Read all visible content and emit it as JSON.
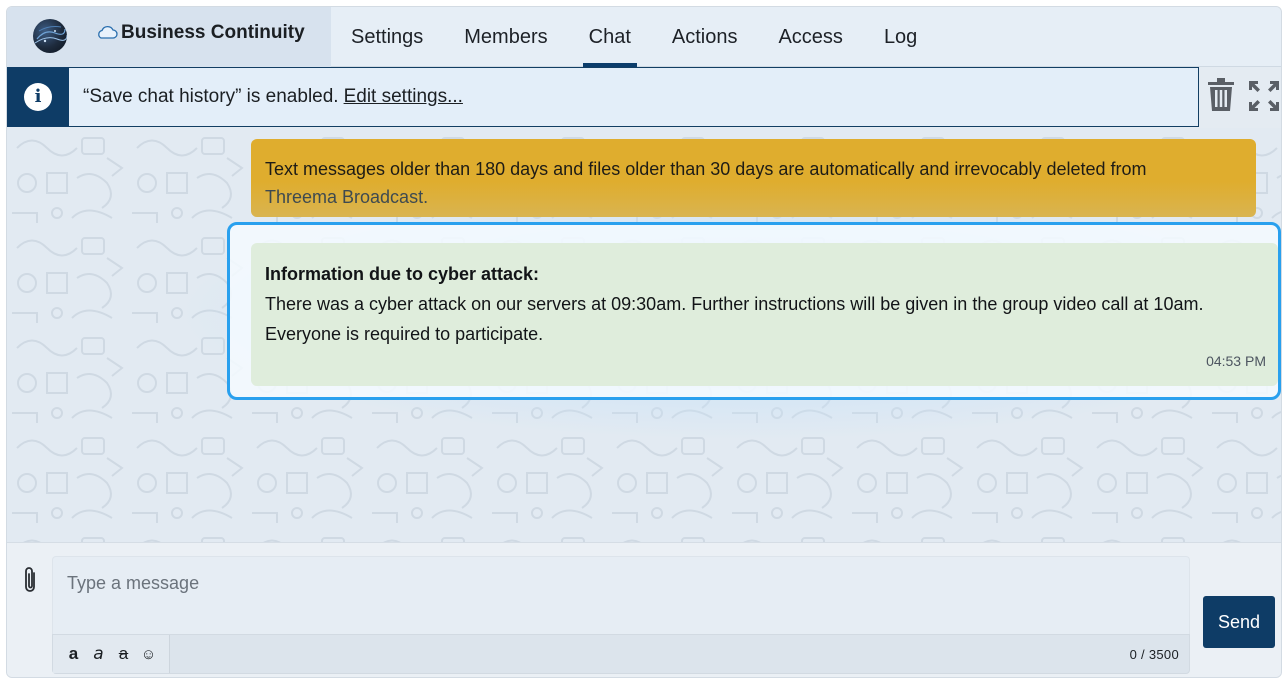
{
  "header": {
    "title": "Business Continuity",
    "tabs": [
      {
        "label": "Settings",
        "active": false
      },
      {
        "label": "Members",
        "active": false
      },
      {
        "label": "Chat",
        "active": true
      },
      {
        "label": "Actions",
        "active": false
      },
      {
        "label": "Access",
        "active": false
      },
      {
        "label": "Log",
        "active": false
      }
    ]
  },
  "infobar": {
    "icon": "info-icon",
    "text": "“Save chat history” is enabled.",
    "link": "Edit settings..."
  },
  "toolbar_icons": [
    "trash-icon",
    "expand-icon"
  ],
  "chat": {
    "notice_line1": "Text messages older than 180 days and files older than 30 days are automatically and irrevocably deleted from",
    "notice_line2": "Threema Broadcast.",
    "message": {
      "title": "Information due to cyber attack:",
      "body": "There was a cyber attack on our servers at 09:30am. Further instructions will be given in the group video call at 10am. Everyone is required to participate.",
      "time": "04:53 PM"
    }
  },
  "composer": {
    "placeholder": "Type a message",
    "format_buttons": [
      "a",
      "a",
      "a",
      "☺"
    ],
    "counter": "0 / 3500",
    "send_label": "Send"
  },
  "colors": {
    "primary": "#0e3c66",
    "notice_bg": "#dfad2e",
    "message_bg": "#dfeddc",
    "highlight": "#29a0ee"
  }
}
